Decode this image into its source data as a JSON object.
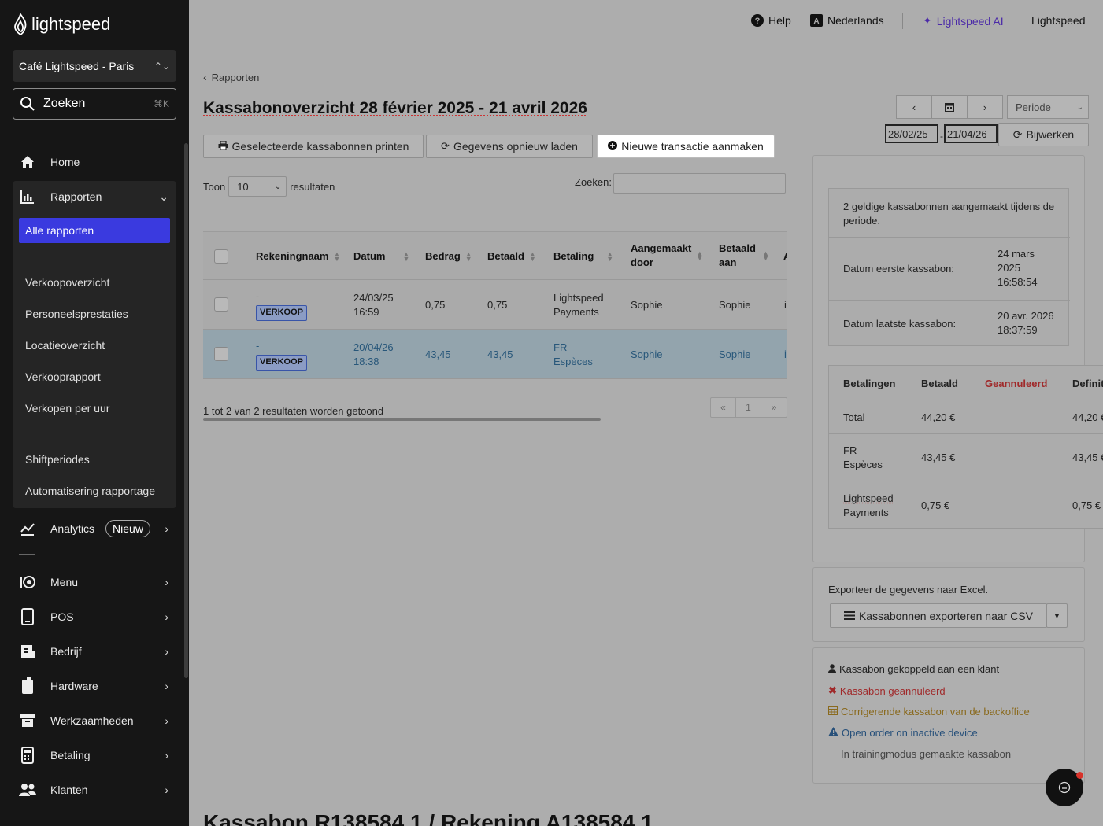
{
  "brand": {
    "name": "lightspeed"
  },
  "sidebar": {
    "store": "Café Lightspeed - Paris",
    "search": {
      "label": "Zoeken",
      "shortcut": "⌘K"
    },
    "home": "Home",
    "rapporten": "Rapporten",
    "alle_rapporten": "Alle rapporten",
    "reports": [
      "Verkoopoverzicht",
      "Personeelsprestaties",
      "Locatieoverzicht",
      "Verkooprapport",
      "Verkopen per uur"
    ],
    "reports2": [
      "Shiftperiodes",
      "Automatisering rapportage"
    ],
    "analytics": "Analytics",
    "analytics_badge": "Nieuw",
    "items": [
      "Menu",
      "POS",
      "Bedrijf",
      "Hardware",
      "Werkzaamheden",
      "Betaling",
      "Klanten"
    ]
  },
  "topbar": {
    "help": "Help",
    "language": "Nederlands",
    "ai": "Lightspeed AI",
    "account": "Lightspeed"
  },
  "main": {
    "breadcrumb": "Rapporten",
    "title": "Kassabonoverzicht 28 février 2025 - 21 avril 2026",
    "buttons": {
      "print": "Geselecteerde kassabonnen printen",
      "reload": "Gegevens opnieuw laden",
      "new": "Nieuwe transactie aanmaken"
    },
    "toon_label": "Toon",
    "toon_value": "10",
    "resultaten_label": "resultaten",
    "zoeken_label": "Zoeken:",
    "table": {
      "headers": [
        "Rekeningnaam",
        "Datum",
        "Bedrag",
        "Betaald",
        "Betaling",
        "Aangemaakt door",
        "Betaald aan",
        "A"
      ],
      "rows": [
        {
          "name": "-",
          "tag": "VERKOOP",
          "date1": "24/03/25",
          "date2": "16:59",
          "bedrag": "0,75",
          "betaald": "0,75",
          "bet1": "Lightspeed",
          "bet2": "Payments",
          "door": "Sophie",
          "aan": "Sophie",
          "extra": "i"
        },
        {
          "name": "-",
          "tag": "VERKOOP",
          "date1": "20/04/26",
          "date2": "18:38",
          "bedrag": "43,45",
          "betaald": "43,45",
          "bet1": "FR",
          "bet2": "Espèces",
          "door": "Sophie",
          "aan": "Sophie",
          "extra": "i"
        }
      ]
    },
    "result_info": "1 tot 2 van 2 resultaten worden getoond",
    "pager": {
      "prev": "«",
      "page": "1",
      "next": "»"
    },
    "periode": "Periode",
    "date_from": "28/02/25",
    "date_to": "21/04/26",
    "update": "Bijwerken",
    "summary": {
      "count_text": "2 geldige kassabonnen aangemaakt tijdens de periode.",
      "first_label": "Datum eerste kassabon:",
      "first_value": [
        "24 mars",
        "2025",
        "16:58:54"
      ],
      "last_label": "Datum laatste kassabon:",
      "last_value": [
        "20 avr. 2026",
        "18:37:59"
      ]
    },
    "payments": {
      "headers": [
        "Betalingen",
        "Betaald",
        "Geannuleerd",
        "Definit"
      ],
      "rows": [
        {
          "name1": "Total",
          "name2": "",
          "paid": "44,20 €",
          "def": "44,20 €"
        },
        {
          "name1": "FR",
          "name2": "Espèces",
          "paid": "43,45 €",
          "def": "43,45 €"
        },
        {
          "name1": "Lightspeed",
          "name2": "Payments",
          "paid": "0,75 €",
          "def": "0,75 €"
        }
      ]
    },
    "export": {
      "label": "Exporteer de gegevens naar Excel.",
      "button": "Kassabonnen exporteren naar CSV"
    },
    "legend": {
      "customer": "Kassabon gekoppeld aan een klant",
      "cancelled": "Kassabon geannuleerd",
      "corrective": "Corrigerende kassabon van de backoffice",
      "inactive": "Open order on inactive device",
      "training": "In trainingmodus gemaakte kassabon"
    },
    "bottom_title": "Kassabon R138584.1 / Rekening A138584.1"
  },
  "colors": {
    "accent": "#3a3adf",
    "ai": "#4b2aa8",
    "cancelled": "#a0292a",
    "corrective": "#8a6a1e",
    "inactive": "#27507a"
  }
}
